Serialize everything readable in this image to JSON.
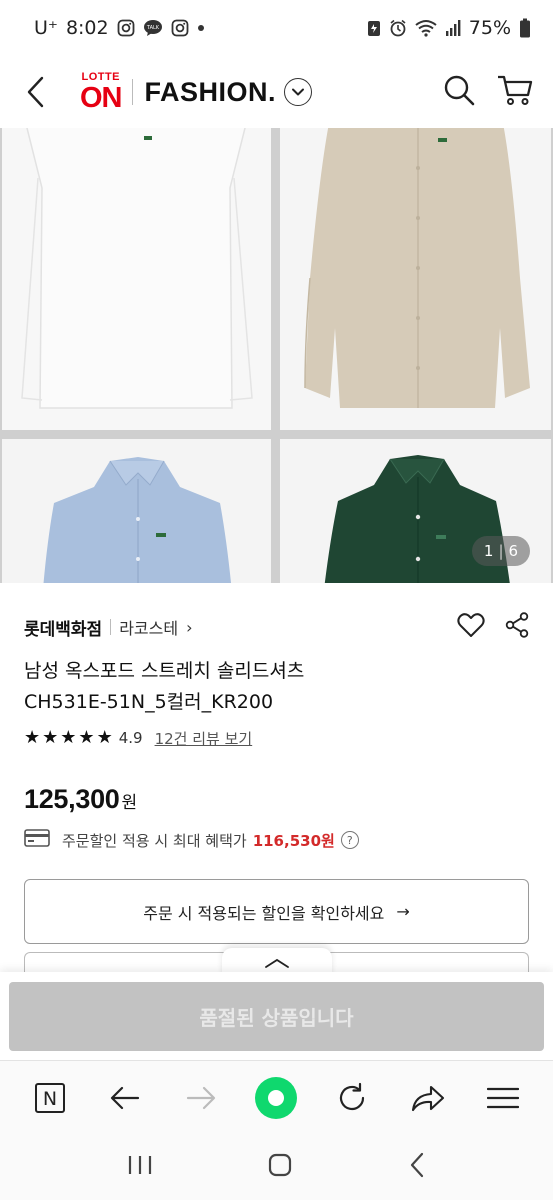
{
  "status_bar": {
    "carrier": "U⁺",
    "time": "8:02",
    "battery": "75%"
  },
  "header": {
    "logo_small": "LOTTE",
    "logo_big": "ON",
    "title": "FASHION."
  },
  "gallery": {
    "current": "1",
    "total": "6",
    "shirt_colors": [
      "#f8f8f8",
      "#d6cbb8",
      "#a9bfdd",
      "#1f4633"
    ]
  },
  "seller": {
    "store": "롯데백화점",
    "brand": "라코스테",
    "brand_arrow": "›"
  },
  "product": {
    "name_line1": "남성 옥스포드 스트레치 솔리드셔츠",
    "name_line2": "CH531E-51N_5컬러_KR200",
    "rating": "4.9",
    "review_link": "12건 리뷰 보기",
    "stars": 5,
    "price": "125,300",
    "currency": "원"
  },
  "benefit": {
    "text": "주문할인 적용 시 최대 혜택가",
    "price": "116,530원",
    "help": "?"
  },
  "discount_button": {
    "label": "주문 시 적용되는 할인을 확인하세요",
    "arrow": "→"
  },
  "buy_bar": {
    "soldout_label": "품절된 상품입니다"
  },
  "browser": {
    "naver_letter": "N"
  },
  "colors": {
    "brand_red": "#e60012",
    "benefit_red": "#d32a2a",
    "naver_green": "#0fd86e",
    "soldout_gray": "#c2c2c2"
  }
}
